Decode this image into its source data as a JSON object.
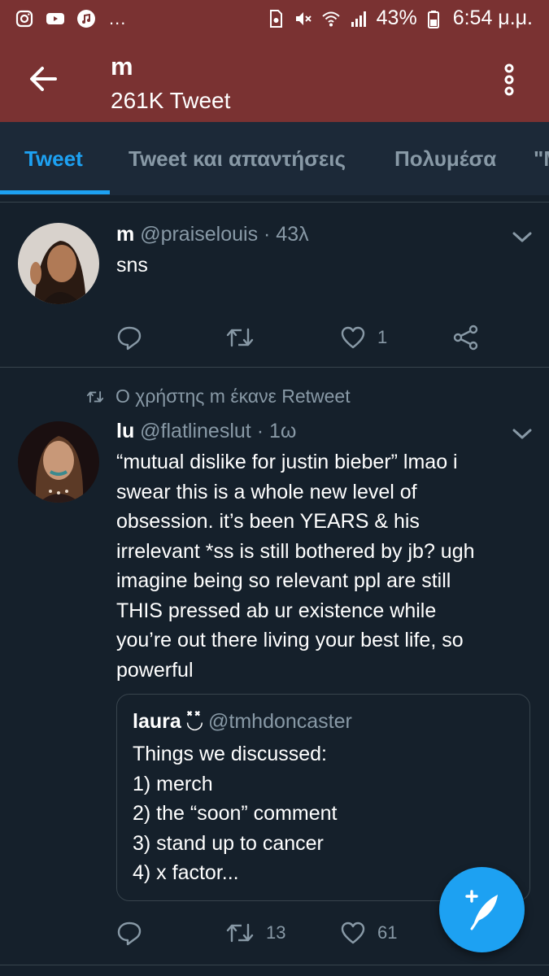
{
  "status_bar": {
    "left_icons": [
      "instagram-icon",
      "youtube-icon",
      "music-icon"
    ],
    "more": "...",
    "battery": "43%",
    "time": "6:54 μ.μ."
  },
  "header": {
    "title": "m",
    "subtitle": "261K Tweet"
  },
  "tabs": [
    {
      "label": "Tweet",
      "active": true
    },
    {
      "label": "Tweet και απαντήσεις",
      "active": false
    },
    {
      "label": "Πολυμέσα",
      "active": false
    },
    {
      "label": "\"Μ",
      "active": false
    }
  ],
  "tweets": [
    {
      "name": "m",
      "handle": "@praiselouis",
      "time": "· 43λ",
      "text": "sns",
      "actions": {
        "reply": "",
        "retweet": "",
        "like": "1",
        "share": ""
      }
    },
    {
      "retweet_context": "Ο χρήστης m έκανε Retweet",
      "name": "lu",
      "handle": "@flatlineslut",
      "time": "· 1ω",
      "text_lines": [
        "“mutual dislike for justin bieber” lmao i",
        "swear this is a whole new level of",
        "obsession. it’s been YEARS & his",
        "irrelevant *ss is still bothered by jb? ugh",
        "imagine being so relevant ppl are still",
        "THIS pressed ab ur existence while",
        "you’re out there living your best life, so",
        "powerful"
      ],
      "quoted": {
        "name": "laura ◟̽◞̽",
        "handle": "@tmhdoncaster",
        "text_lines": [
          "Things we discussed:",
          "1) merch",
          "2) the “soon” comment",
          "3) stand up to cancer",
          "4) x factor..."
        ]
      },
      "actions": {
        "reply": "",
        "retweet": "13",
        "like": "61"
      }
    }
  ],
  "colors": {
    "background": "#15202b",
    "header": "#7a3232",
    "accent": "#1da1f2",
    "muted": "#8899a6"
  }
}
